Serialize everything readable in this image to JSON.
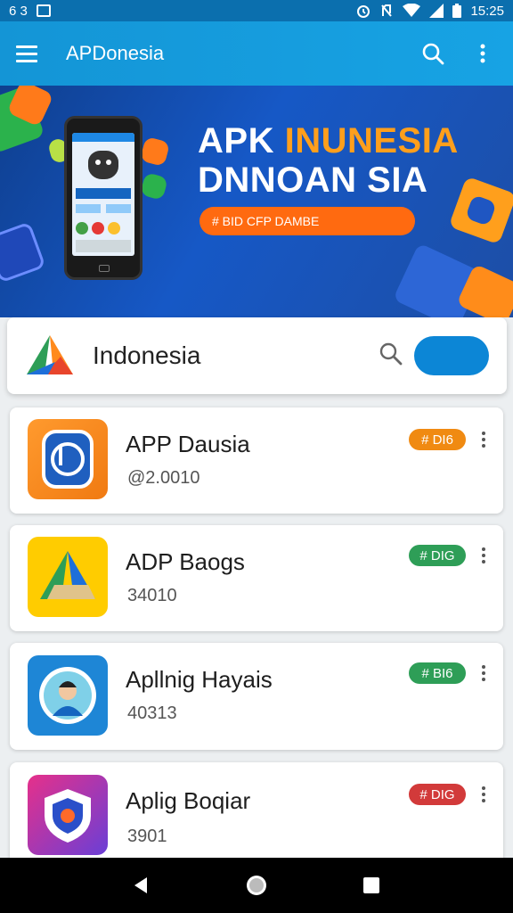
{
  "status_bar": {
    "left_text": "6 3",
    "time": "15:25",
    "icons": [
      "app-notification-icon",
      "alarm-icon",
      "no-sim-icon",
      "wifi-icon",
      "signal-icon",
      "battery-icon"
    ]
  },
  "app_bar": {
    "title": "APDonesia",
    "icons": [
      "menu-icon",
      "search-icon",
      "more-vert-icon"
    ]
  },
  "banner": {
    "headline_line1_white": "APK ",
    "headline_line1_orange": "INUNESIA",
    "headline_line2": "DNNOAN SIA",
    "cta_label": "# BID CFP DAMBE"
  },
  "search": {
    "text": "Indonesia",
    "icons": [
      "brand-logo-icon",
      "search-icon"
    ]
  },
  "apps": [
    {
      "name": "APP Dausia",
      "subtitle": "@2.0010",
      "badge": "# DI6",
      "badge_color": "#f08a12",
      "icon": "shield-app-icon"
    },
    {
      "name": "ADP Baogs",
      "subtitle": "34010",
      "badge": "# DIG",
      "badge_color": "#2e9e57",
      "icon": "drive-app-icon"
    },
    {
      "name": "Apllnig Hayais",
      "subtitle": "40313",
      "badge": "# BI6",
      "badge_color": "#2e9e57",
      "icon": "avatar-app-icon"
    },
    {
      "name": "Aplig Boqiar",
      "subtitle": "3901",
      "badge": "# DIG",
      "badge_color": "#d23a3a",
      "icon": "shield-gradient-app-icon"
    }
  ],
  "nav_bar": {
    "icons": [
      "back-icon",
      "home-icon",
      "recents-icon"
    ]
  }
}
